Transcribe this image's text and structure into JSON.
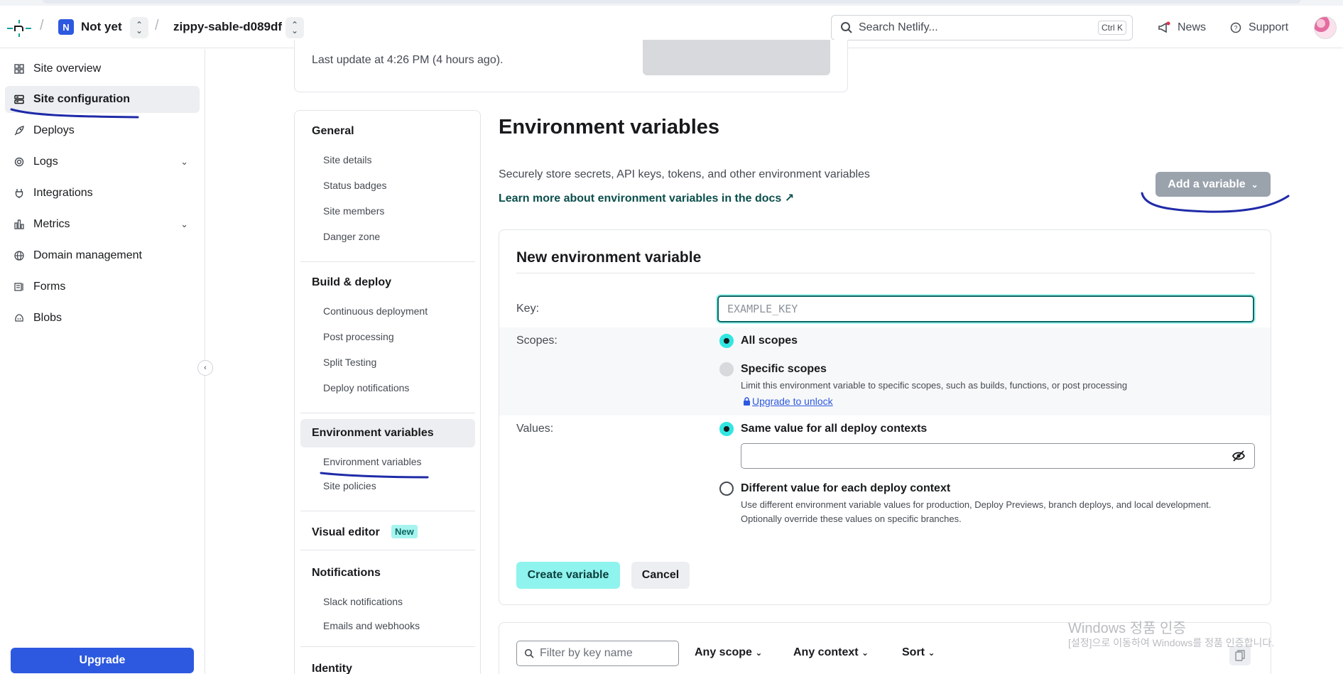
{
  "header": {
    "team_initial": "N",
    "team_name": "Not yet",
    "site_name": "zippy-sable-d089df",
    "search_placeholder": "Search Netlify...",
    "search_shortcut": "Ctrl K",
    "news_label": "News",
    "support_label": "Support"
  },
  "sidebar": {
    "items": [
      {
        "label": "Site overview",
        "icon": "grid-icon"
      },
      {
        "label": "Site configuration",
        "icon": "config-icon",
        "active": true
      },
      {
        "label": "Deploys",
        "icon": "rocket-icon"
      },
      {
        "label": "Logs",
        "icon": "logs-icon",
        "expandable": true
      },
      {
        "label": "Integrations",
        "icon": "plug-icon"
      },
      {
        "label": "Metrics",
        "icon": "bar-chart-icon",
        "expandable": true
      },
      {
        "label": "Domain management",
        "icon": "globe-icon"
      },
      {
        "label": "Forms",
        "icon": "forms-icon"
      },
      {
        "label": "Blobs",
        "icon": "blobs-icon"
      }
    ],
    "upgrade_label": "Upgrade"
  },
  "top_card": {
    "last_update": "Last update at 4:26 PM (4 hours ago)."
  },
  "settings_nav": {
    "general": {
      "title": "General",
      "items": [
        "Site details",
        "Status badges",
        "Site members",
        "Danger zone"
      ]
    },
    "build_deploy": {
      "title": "Build & deploy",
      "items": [
        "Continuous deployment",
        "Post processing",
        "Split Testing",
        "Deploy notifications"
      ]
    },
    "env_vars": {
      "title": "Environment variables",
      "items": [
        "Environment variables",
        "Site policies"
      ]
    },
    "visual_editor": {
      "title": "Visual editor",
      "badge": "New"
    },
    "notifications": {
      "title": "Notifications",
      "items": [
        "Slack notifications",
        "Emails and webhooks"
      ]
    },
    "identity": {
      "title": "Identity"
    }
  },
  "main": {
    "title": "Environment variables",
    "description": "Securely store secrets, API keys, tokens, and other environment variables",
    "docs_link": "Learn more about environment variables in the docs ↗",
    "add_variable_label": "Add a variable"
  },
  "form": {
    "title": "New environment variable",
    "key_label": "Key:",
    "key_placeholder": "EXAMPLE_KEY",
    "scopes_label": "Scopes:",
    "all_scopes": "All scopes",
    "specific_scopes": "Specific scopes",
    "specific_scopes_help": "Limit this environment variable to specific scopes, such as builds, functions, or post processing",
    "upgrade_link": "Upgrade to unlock",
    "values_label": "Values:",
    "same_value": "Same value for all deploy contexts",
    "different_value": "Different value for each deploy context",
    "different_value_help": "Use different environment variable values for production, Deploy Previews, branch deploys, and local development. Optionally override these values on specific branches.",
    "create_label": "Create variable",
    "cancel_label": "Cancel"
  },
  "list": {
    "filter_placeholder": "Filter by key name",
    "scope_filter": "Any scope",
    "context_filter": "Any context",
    "sort_label": "Sort"
  },
  "watermark": {
    "line1": "Windows 정품 인증",
    "line2": "[설정]으로 이동하여 Windows를 정품 인증합니다."
  },
  "colors": {
    "accent_teal": "#32e6e2",
    "brand_blue": "#2d59e0",
    "annotation_ink": "#1f2aa8"
  }
}
